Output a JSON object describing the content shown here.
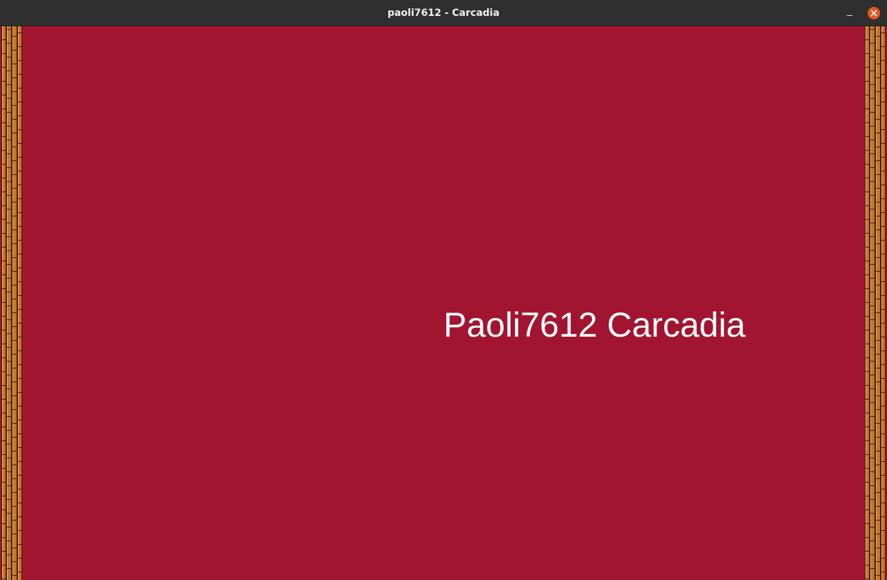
{
  "window": {
    "title": "paoli7612 - Carcadia",
    "controls": {
      "minimize_icon": "minimize-icon",
      "close_icon": "close-icon"
    }
  },
  "game": {
    "banner_text": "Paoli7612 Carcadia"
  },
  "colors": {
    "titlebar": "#2f2f2f",
    "background": "#a11531",
    "close_button": "#e95420",
    "border_wood": "#c8742e",
    "border_light": "#f0c060",
    "border_dark": "#3a1e08",
    "text": "#ffffff"
  }
}
